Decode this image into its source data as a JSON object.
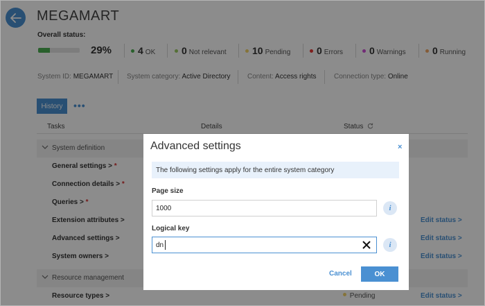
{
  "header": {
    "title": "MEGAMART"
  },
  "overall": {
    "label": "Overall status:",
    "progress": 0.29,
    "percent_text": "29%",
    "stats": [
      {
        "count": "4",
        "label": "OK",
        "color": "#4caf50"
      },
      {
        "count": "0",
        "label": "Not relevant",
        "color": "#9ccc65"
      },
      {
        "count": "10",
        "label": "Pending",
        "color": "#f3d36b"
      },
      {
        "count": "0",
        "label": "Errors",
        "color": "#e53935"
      },
      {
        "count": "0",
        "label": "Warnings",
        "color": "#d04fd8"
      },
      {
        "count": "0",
        "label": "Running",
        "color": "#f0a868"
      }
    ]
  },
  "meta": {
    "system_id_label": "System ID:",
    "system_id": "MEGAMART",
    "category_label": "System category:",
    "category": "Active Directory",
    "content_label": "Content:",
    "content": "Access rights",
    "connection_label": "Connection type:",
    "connection": "Online"
  },
  "tabs": {
    "history": "History",
    "more": "•••"
  },
  "table": {
    "columns": {
      "tasks": "Tasks",
      "details": "Details",
      "status": "Status"
    },
    "sections": [
      {
        "label": "System definition"
      },
      {
        "label": "Resource management"
      }
    ],
    "tasks": [
      {
        "label": "General settings",
        "required": true,
        "edit": ""
      },
      {
        "label": "Connection details",
        "required": true,
        "edit": ""
      },
      {
        "label": "Queries",
        "required": true,
        "edit": ""
      },
      {
        "label": "Extension attributes",
        "required": false,
        "edit": "Edit status"
      },
      {
        "label": "Advanced settings",
        "required": false,
        "edit": "Edit status"
      },
      {
        "label": "System owners",
        "required": false,
        "edit": "Edit status"
      },
      {
        "label": "Resource types",
        "required": false,
        "edit": "Edit status",
        "status": "Pending"
      }
    ],
    "required_marker": "*",
    "chevron": ">"
  },
  "modal": {
    "title": "Advanced settings",
    "close": "×",
    "info": "The following settings apply for the entire system category",
    "page_size_label": "Page size",
    "page_size_value": "1000",
    "logical_key_label": "Logical key",
    "logical_key_value": "dn",
    "info_icon": "i",
    "cancel": "Cancel",
    "ok": "OK"
  },
  "colors": {
    "accent": "#4a90d2",
    "required": "#d32f2f"
  }
}
